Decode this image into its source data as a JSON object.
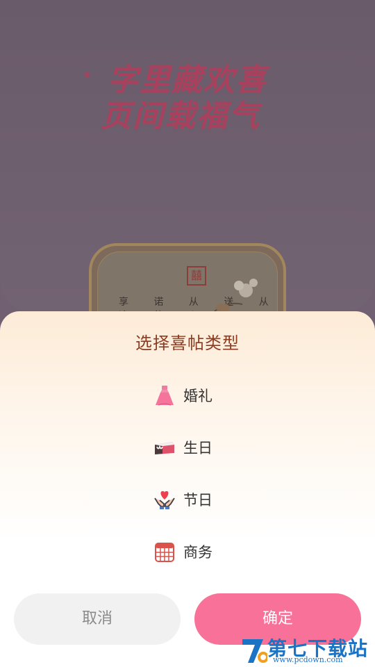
{
  "background": {
    "title_line1": "字里藏欢喜",
    "title_line2": "页间载福气",
    "seal": "囍",
    "verse": "享 诺 从 送 从\n这 的 心 只",
    "sparkle": "✦"
  },
  "sheet": {
    "title": "选择喜帖类型",
    "options": [
      {
        "label": "婚礼",
        "icon": "wedding-dress-icon"
      },
      {
        "label": "生日",
        "icon": "birthday-cake-icon"
      },
      {
        "label": "节日",
        "icon": "heart-hands-icon"
      },
      {
        "label": "商务",
        "icon": "calendar-building-icon"
      }
    ],
    "cancel_label": "取消",
    "confirm_label": "确定"
  },
  "watermark": {
    "text": "第七下载站",
    "sub": "www.pcdown.com"
  },
  "colors": {
    "accent": "#f87198",
    "title": "#8e3a1f",
    "cancel_bg": "#f1f1f1"
  }
}
